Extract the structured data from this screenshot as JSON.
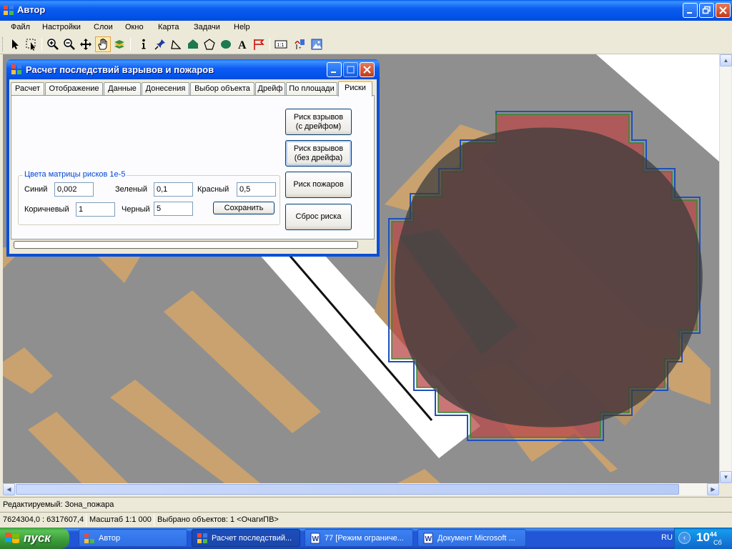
{
  "main_window": {
    "title": "Автор",
    "menu": [
      "Файл",
      "Настройки",
      "Слои",
      "Окно",
      "Карта",
      "Задачи",
      "Help"
    ]
  },
  "toolbar": {
    "icons": [
      "pointer-icon",
      "select-icon",
      "zoom-in-icon",
      "zoom-out-icon",
      "pan-icon",
      "hand-icon",
      "layers-icon",
      "info-icon",
      "pin-icon",
      "polyline-icon",
      "polygon-icon",
      "pentagon-icon",
      "ellipse-icon",
      "text-icon",
      "flag-icon",
      "scale-icon",
      "measure-icon",
      "image-icon"
    ],
    "scale_label": "1:1"
  },
  "dialog": {
    "title": "Расчет последствий взрывов и пожаров",
    "tabs": [
      "Расчет",
      "Отображение",
      "Данные",
      "Донесения",
      "Выбор объекта",
      "Дрейф",
      "По площади",
      "Риски"
    ],
    "selected_tab": "Риски",
    "buttons": {
      "explosion_drift": [
        "Риск взрывов",
        "(с дрейфом)"
      ],
      "explosion_no_drift": [
        "Риск взрывов",
        "(без дрейфа)"
      ],
      "fire": "Риск пожаров",
      "reset": "Сброс риска",
      "save": "Сохранить"
    },
    "group": {
      "legend": "Цвета матрицы рисков 1е-5",
      "blue_label": "Синий",
      "blue_value": "0,002",
      "green_label": "Зеленый",
      "green_value": "0,1",
      "red_label": "Красный",
      "red_value": "0,5",
      "brown_label": "Коричневый",
      "brown_value": "1",
      "black_label": "Черный",
      "black_value": "5"
    },
    "progress": 0
  },
  "status": {
    "editing": "Редактируемый: Зона_пожара",
    "coords": "7624304,0 : 6317607,4",
    "scale": "Масштаб 1:1 000",
    "selected": "Выбрано объектов: 1 <ОчагиПВ>"
  },
  "taskbar": {
    "start": "пуск",
    "tasks": [
      "Автор",
      "Расчет последствий...",
      "77 [Режим ограниче...",
      "Документ Microsoft ..."
    ],
    "lang": "RU",
    "time_hour": "10",
    "time_min": "44",
    "day": "Сб"
  },
  "colors": {
    "map_background": "#8F8F8F",
    "building": "#C9A26F",
    "road": "#FFFFFF",
    "zone_red": "#B84848",
    "zone_dark": "#444444"
  }
}
